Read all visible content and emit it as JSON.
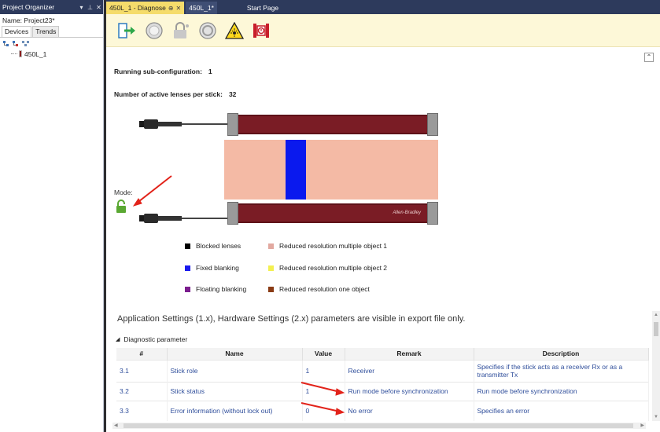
{
  "project_organizer": {
    "title": "Project Organizer",
    "controls": [
      "▾",
      "⊥",
      "✕"
    ],
    "name_label": "Name: Project23*",
    "tabs": [
      "Devices",
      "Trends"
    ],
    "toolbar_icons": [
      "add-device-icon",
      "remove-device-icon",
      "network-icon"
    ],
    "tree_item": "450L_1"
  },
  "doc_tabs": [
    {
      "label": "450L_1 - Diagnose",
      "pin": "⊕",
      "close": "✕",
      "active": true
    },
    {
      "label": "450L_1*",
      "active": false
    },
    {
      "label": "Start Page",
      "active": false
    }
  ],
  "toolbar_icons": [
    "go-online-icon",
    "circle-off-icon",
    "lock-icon",
    "circle-ring-icon",
    "laser-warning-icon",
    "device-alert-icon"
  ],
  "collapse_glyph": "⌃",
  "info": {
    "subconfig_label": "Running sub-configuration:",
    "subconfig_value": "1",
    "lenses_label": "Number of active lenses per stick:",
    "lenses_value": "32"
  },
  "mode_label": "Mode:",
  "brand": "Allen-Bradley",
  "legend": [
    {
      "id": "blocked",
      "label": "Blocked lenses",
      "color": "#000000"
    },
    {
      "id": "fixed",
      "label": "Fixed blanking",
      "color": "#1a1aee"
    },
    {
      "id": "floating",
      "label": "Floating blanking",
      "color": "#7b1d8e"
    },
    {
      "id": "rr1",
      "label": "Reduced resolution multiple object 1",
      "color": "#e2a9a0"
    },
    {
      "id": "rr2",
      "label": "Reduced resolution multiple object 2",
      "color": "#f3f051"
    },
    {
      "id": "rr3",
      "label": "Reduced resolution one object",
      "color": "#8a3b15"
    }
  ],
  "app_note": "Application Settings (1.x), Hardware Settings (2.x) parameters are visible in export file only.",
  "diag_group": {
    "arrow": "◢",
    "label": "Diagnostic parameter"
  },
  "table": {
    "headers": [
      "#",
      "Name",
      "Value",
      "Remark",
      "Description"
    ],
    "rows": [
      {
        "num": "3.1",
        "name": "Stick role",
        "value": "1",
        "remark": "Receiver",
        "description": "Specifies if the stick acts as a receiver Rx or as a transmitter Tx"
      },
      {
        "num": "3.2",
        "name": "Stick status",
        "value": "1",
        "remark": "Run mode before synchronization",
        "description": "Run mode before synchronization"
      },
      {
        "num": "3.3",
        "name": "Error information (without lock out)",
        "value": "0",
        "remark": "No error",
        "description": "Specifies an error"
      }
    ]
  },
  "colors": {
    "sticks": "#7a1c25",
    "beam": "#f4baa5",
    "fixed_blanking": "#0a19ee",
    "toolbar_bg": "#fdf8d8",
    "annotation": "#e2231a"
  }
}
